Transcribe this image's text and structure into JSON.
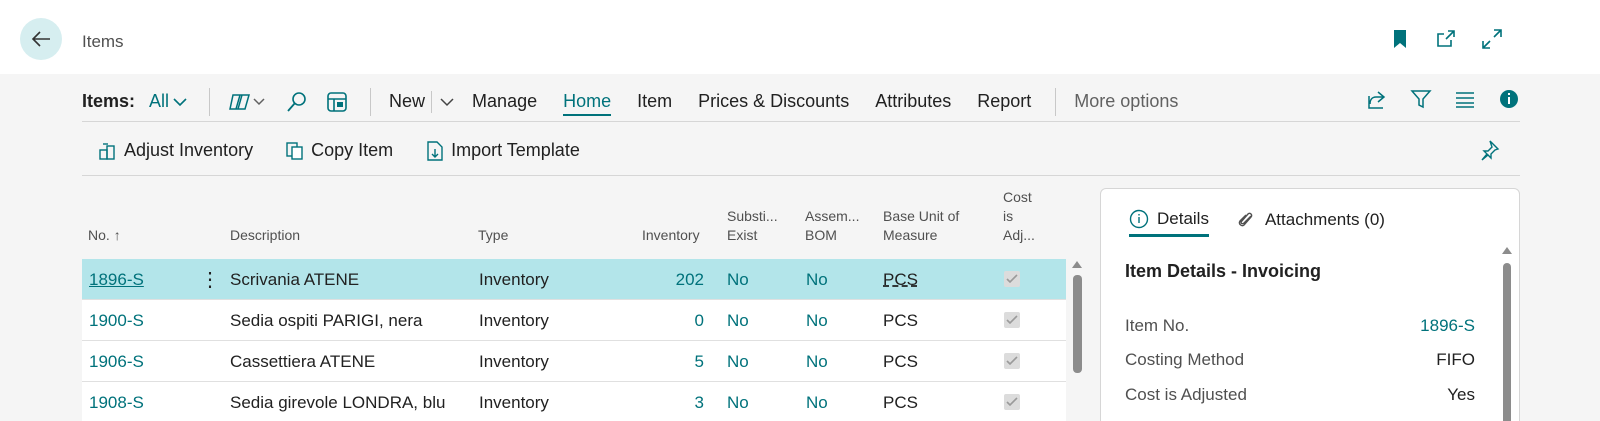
{
  "page": {
    "title": "Items"
  },
  "actionbar": {
    "label": "Items:",
    "filter": "All",
    "menu": [
      "New",
      "Manage",
      "Home",
      "Item",
      "Prices & Discounts",
      "Attributes",
      "Report"
    ],
    "more": "More options"
  },
  "subbar": {
    "items": [
      "Adjust Inventory",
      "Copy Item",
      "Import Template"
    ]
  },
  "grid": {
    "headers": {
      "no": "No.",
      "sort_icon": "arrow-up-icon",
      "description": "Description",
      "type": "Type",
      "inventory": "Inventory",
      "subst_1": "Substi...",
      "subst_2": "Exist",
      "assem_1": "Assem...",
      "assem_2": "BOM",
      "base_1": "Base Unit of",
      "base_2": "Measure",
      "cost_1": "Cost",
      "cost_2": "is",
      "cost_3": "Adj..."
    },
    "rows": [
      {
        "no": "1896-S",
        "description": "Scrivania ATENE",
        "type": "Inventory",
        "inventory": "202",
        "subst": "No",
        "assem": "No",
        "base": "PCS"
      },
      {
        "no": "1900-S",
        "description": "Sedia ospiti PARIGI, nera",
        "type": "Inventory",
        "inventory": "0",
        "subst": "No",
        "assem": "No",
        "base": "PCS"
      },
      {
        "no": "1906-S",
        "description": "Cassettiera ATENE",
        "type": "Inventory",
        "inventory": "5",
        "subst": "No",
        "assem": "No",
        "base": "PCS"
      },
      {
        "no": "1908-S",
        "description": "Sedia girevole LONDRA, blu",
        "type": "Inventory",
        "inventory": "3",
        "subst": "No",
        "assem": "No",
        "base": "PCS"
      }
    ]
  },
  "factbox": {
    "tab_details": "Details",
    "tab_attachments": "Attachments (0)",
    "title": "Item Details - Invoicing",
    "fields": [
      {
        "label": "Item No.",
        "value": "1896-S"
      },
      {
        "label": "Costing Method",
        "value": "FIFO"
      },
      {
        "label": "Cost is Adjusted",
        "value": "Yes"
      }
    ]
  },
  "colors": {
    "accent": "#00727b",
    "selected_row": "#b3e5ea"
  }
}
